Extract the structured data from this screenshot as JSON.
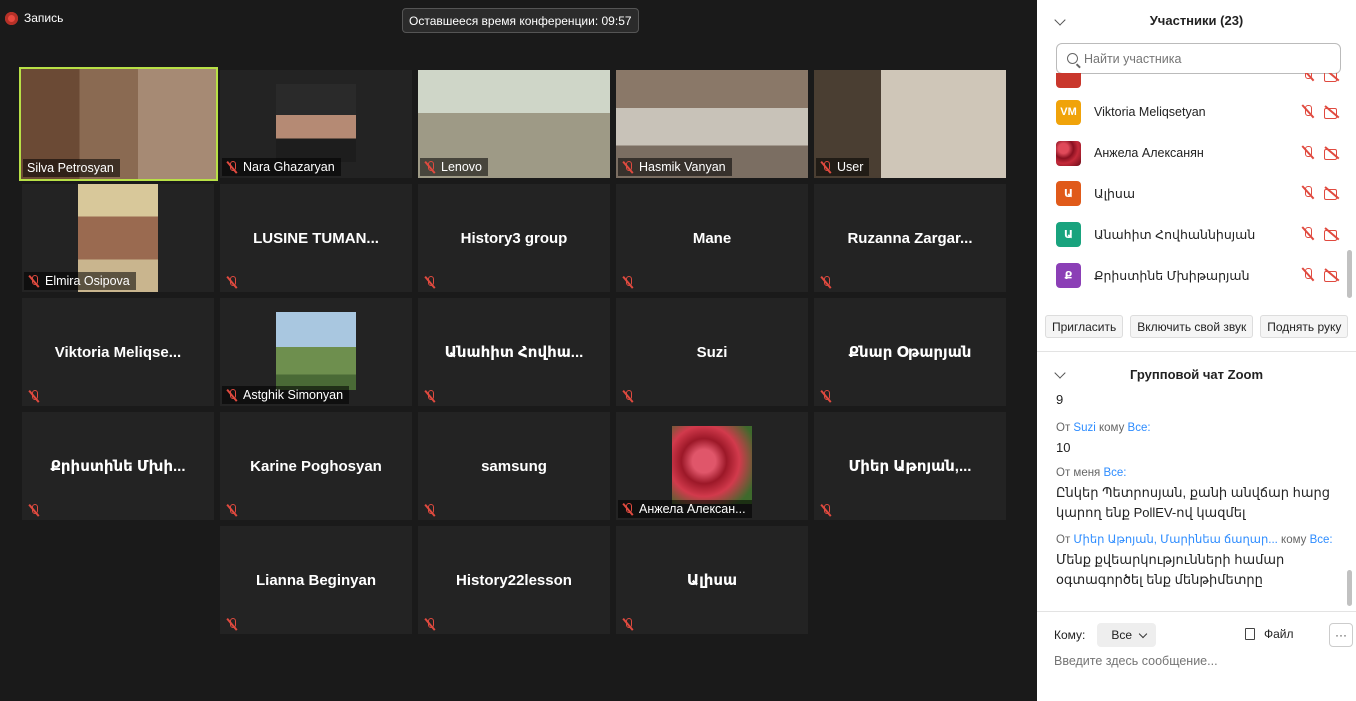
{
  "recording": {
    "label": "Запись"
  },
  "timer": {
    "text": "Оставшееся время конференции: 09:57"
  },
  "tiles": [
    {
      "name": "Silva Petrosyan",
      "label": true,
      "video": true,
      "active": true
    },
    {
      "name": "Nara Ghazaryan",
      "label": true,
      "video": true
    },
    {
      "name": "Lenovo",
      "label": true,
      "video": true
    },
    {
      "name": "Hasmik Vanyan",
      "label": true,
      "video": true
    },
    {
      "name": "User",
      "label": true,
      "video": true
    },
    {
      "name": "Elmira Osipova",
      "label": true,
      "video": true
    },
    {
      "name": "LUSINE TUMAN..."
    },
    {
      "name": "History3 group"
    },
    {
      "name": "Mane"
    },
    {
      "name": "Ruzanna  Zargar..."
    },
    {
      "name": "Viktoria  Meliqse..."
    },
    {
      "name": "Astghik Simonyan",
      "label": true,
      "video": true
    },
    {
      "name": "Անահիտ Հովհա..."
    },
    {
      "name": "Suzi"
    },
    {
      "name": "Քնար Օթարյան"
    },
    {
      "name": "Քրիստինե Մխի..."
    },
    {
      "name": "Karine Poghosyan"
    },
    {
      "name": "samsung"
    },
    {
      "name": "Анжела Алексан...",
      "label": true,
      "video": true
    },
    {
      "name": "Միեր Աթոյան,..."
    },
    {
      "name": "Lianna Beginyan"
    },
    {
      "name": "History22lesson"
    },
    {
      "name": "Ալիսա"
    }
  ],
  "participants": {
    "title": "Участники (23)",
    "search_placeholder": "Найти участника",
    "items": [
      {
        "name": "",
        "initials": "",
        "color": "#c9372c"
      },
      {
        "name": "Viktoria Meliqsetyan",
        "initials": "VM",
        "color": "#f0a30a"
      },
      {
        "name": "Анжела Алексанян",
        "initials": "",
        "color": "#a3151f"
      },
      {
        "name": "Ալիսա",
        "initials": "Ա",
        "color": "#e05a1a"
      },
      {
        "name": "Անահիտ Հովհաննիսյան",
        "initials": "Ա",
        "color": "#19a37e"
      },
      {
        "name": "Քրիստինե Մխիթարյան",
        "initials": "Ք",
        "color": "#8b3fb6"
      }
    ],
    "buttons": {
      "invite": "Пригласить",
      "unmute": "Включить свой звук",
      "raise_hand": "Поднять руку"
    }
  },
  "chat": {
    "title": "Групповой чат Zoom",
    "messages": [
      {
        "head": null,
        "body": "9"
      },
      {
        "prefix": "От ",
        "sender": "Suzi",
        "mid": " кому ",
        "to": "Все:",
        "body": "10"
      },
      {
        "prefix": "От меня ",
        "sender": "",
        "mid": "",
        "to": "Все:",
        "body": "Ընկեր Պետրոսյան, քանի  անվճար  հարց կարող  ենք  PollEV-ով  կազմել"
      },
      {
        "prefix": "От ",
        "sender": "Միեր Աթոյան, Մարինեա ճաղար...",
        "mid": " кому ",
        "to": "Все:",
        "body": "Մենք քվեարկությունների համար օգտագործել ենք մենթիմետրը"
      }
    ],
    "to_label": "Кому:",
    "to_value": "Все",
    "file_label": "Файл",
    "more_label": "···",
    "input_placeholder": "Введите здесь сообщение..."
  }
}
